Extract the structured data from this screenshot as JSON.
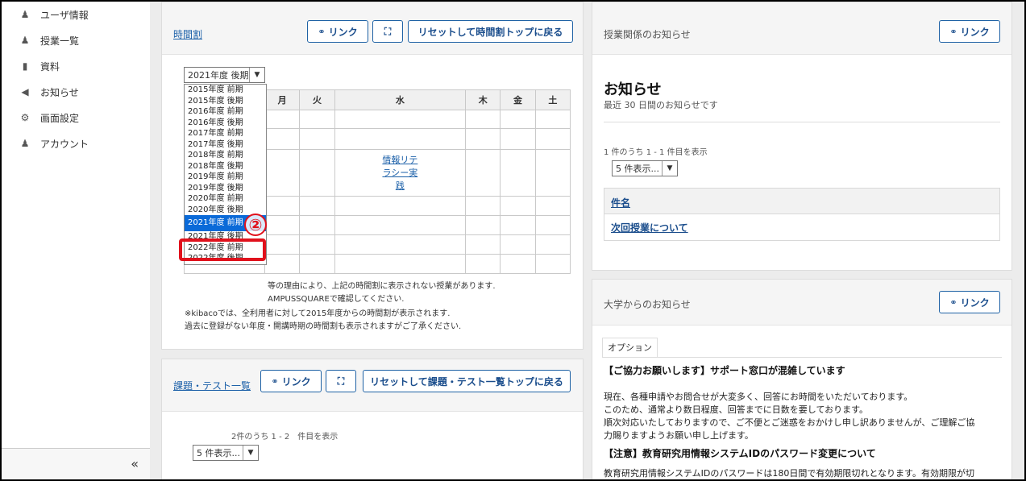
{
  "sidebar": {
    "items": [
      {
        "label": "ユーザ情報",
        "icon": "user-icon"
      },
      {
        "label": "授業一覧",
        "icon": "group-icon"
      },
      {
        "label": "資料",
        "icon": "folder-icon"
      },
      {
        "label": "お知らせ",
        "icon": "megaphone-icon"
      },
      {
        "label": "画面設定",
        "icon": "gear-icon"
      },
      {
        "label": "アカウント",
        "icon": "user-icon"
      }
    ],
    "collapse_glyph": "«"
  },
  "timetable": {
    "title": "時間割",
    "link_button": "リンク",
    "expand_glyph": "⛶",
    "reset_button": "リセットして時間割トップに戻る",
    "selected_term": "2021年度 後期",
    "days": [
      "月",
      "火",
      "水",
      "木",
      "金",
      "土"
    ],
    "course_cell": "情報リテラシー実践",
    "course_lines": [
      "情報リテ",
      "ラシー実",
      "践"
    ],
    "term_options": [
      "2015年度 前期",
      "2015年度 後期",
      "2016年度 前期",
      "2016年度 後期",
      "2017年度 前期",
      "2017年度 後期",
      "2018年度 前期",
      "2018年度 後期",
      "2019年度 前期",
      "2019年度 後期",
      "2020年度 前期",
      "2020年度 後期",
      "2021年度 前期",
      "2021年度 後期",
      "2022年度 前期",
      "2022年度 後期"
    ],
    "highlighted_option": "2021年度 前期",
    "annotation_number": "②",
    "notes": [
      "等の理由により、上記の時間割に表示されない授業があります.",
      "AMPUSSQUAREで確認してください.",
      "※kibacoでは、全利用者に対して2015年度からの時間割が表示されます.",
      "過去に登録がない年度・開講時期の時間割も表示されますがご了承ください."
    ]
  },
  "assignments": {
    "title": "課題・テスト一覧",
    "link_button": "リンク",
    "reset_button": "リセットして課題・テスト一覧トップに戻る",
    "count_text": "2件のうち 1 - 2　件目を表示",
    "page_size": "5 件表示..."
  },
  "course_news": {
    "title": "授業関係のお知らせ",
    "link_button": "リンク",
    "heading": "お知らせ",
    "subheading": "最近 30 日間のお知らせです",
    "count_text": "1 件のうち 1 - 1 件目を表示",
    "page_size": "5 件表示...",
    "column_header": "件名",
    "rows": [
      "次回授業について"
    ]
  },
  "univ_news": {
    "title": "大学からのお知らせ",
    "link_button": "リンク",
    "options_tab": "オプション",
    "item1_title": "【ご協力お願いします】サポート窓口が混雑しています",
    "item1_lines": [
      "現在、各種申請やお問合せが大変多く、回答にお時間をいただいております。",
      "このため、通常より数日程度、回答までに日数を要しております。",
      "順次対応いたしておりますので、ご不便とご迷惑をおかけし申し訳ありませんが、ご理解ご協",
      "力賜りますようお願い申し上げます。"
    ],
    "item2_title": "【注意】教育研究用情報システムIDのパスワード変更について",
    "item2_line": "教育研究用情報システムIDのパスワードは180日間で有効期限切れとなります。有効期限が切"
  },
  "colors": {
    "accent": "#1a4d8c",
    "highlight": "#e0111c",
    "selected": "#0a6ad8"
  }
}
